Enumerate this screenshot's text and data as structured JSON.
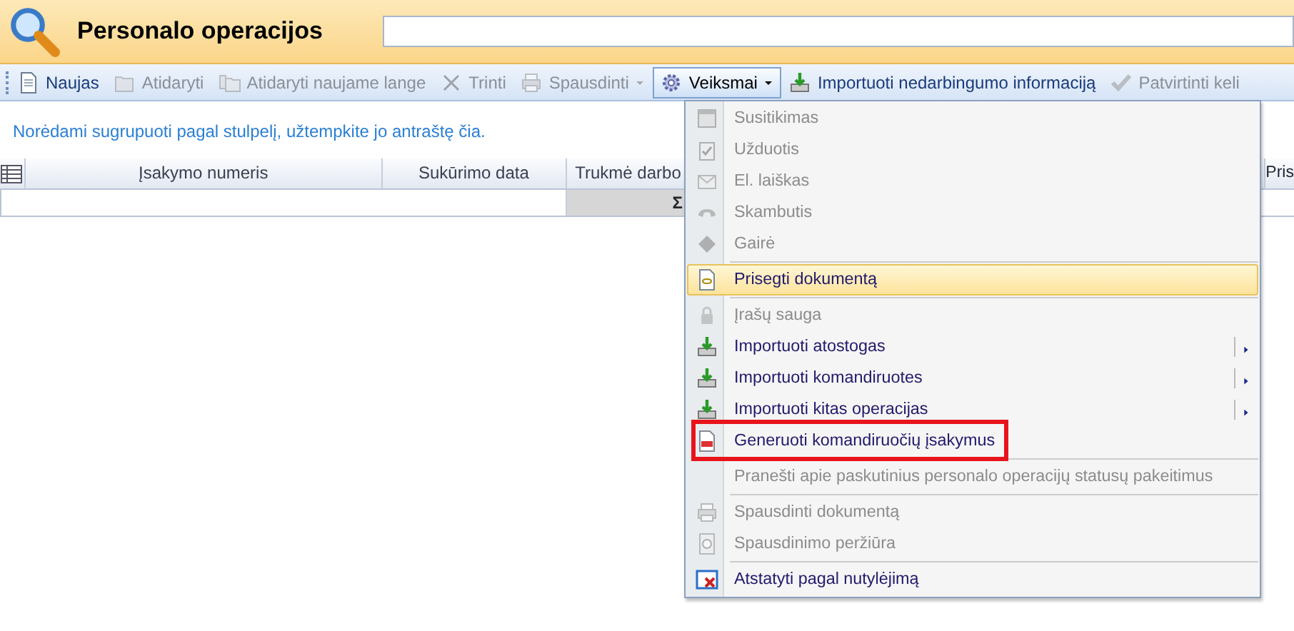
{
  "header": {
    "title": "Personalo operacijos"
  },
  "toolbar": [
    {
      "label": "Naujas",
      "disabled": false,
      "dropdown": false,
      "expanded": false
    },
    {
      "label": "Atidaryti",
      "disabled": true,
      "dropdown": false,
      "expanded": false
    },
    {
      "label": "Atidaryti naujame lange",
      "disabled": true,
      "dropdown": false,
      "expanded": false
    },
    {
      "label": "Trinti",
      "disabled": true,
      "dropdown": false,
      "expanded": false
    },
    {
      "label": "Spausdinti",
      "disabled": true,
      "dropdown": true,
      "expanded": false
    },
    {
      "label": "Veiksmai",
      "disabled": false,
      "dropdown": true,
      "expanded": true
    },
    {
      "label": "Importuoti nedarbingumo informaciją",
      "disabled": false,
      "dropdown": false,
      "expanded": false
    },
    {
      "label": "Patvirtinti keli",
      "disabled": true,
      "dropdown": false,
      "expanded": false
    }
  ],
  "grid": {
    "hint": "Norėdami sugrupuoti pagal stulpelį, užtempkite jo antraštę čia.",
    "columns": [
      {
        "label": "Įsakymo numeris"
      },
      {
        "label": "Sukūrimo data"
      },
      {
        "label": "Trukmė darbo"
      },
      {
        "label": "Pris"
      }
    ],
    "summary_sign": "Σ"
  },
  "menu": [
    {
      "kind": "item",
      "label": "Susitikimas",
      "disabled": true,
      "selected": false,
      "submenu": false,
      "annotated": false
    },
    {
      "kind": "item",
      "label": "Užduotis",
      "disabled": true,
      "selected": false,
      "submenu": false,
      "annotated": false
    },
    {
      "kind": "item",
      "label": "El. laiškas",
      "disabled": true,
      "selected": false,
      "submenu": false,
      "annotated": false
    },
    {
      "kind": "item",
      "label": "Skambutis",
      "disabled": true,
      "selected": false,
      "submenu": false,
      "annotated": false
    },
    {
      "kind": "item",
      "label": "Gairė",
      "disabled": true,
      "selected": false,
      "submenu": false,
      "annotated": false
    },
    {
      "kind": "separator"
    },
    {
      "kind": "item",
      "label": "Prisegti dokumentą",
      "disabled": false,
      "selected": true,
      "submenu": false,
      "annotated": false
    },
    {
      "kind": "separator"
    },
    {
      "kind": "item",
      "label": "Įrašų sauga",
      "disabled": true,
      "selected": false,
      "submenu": false,
      "annotated": false
    },
    {
      "kind": "item",
      "label": "Importuoti atostogas",
      "disabled": false,
      "selected": false,
      "submenu": true,
      "annotated": false
    },
    {
      "kind": "item",
      "label": "Importuoti komandiruotes",
      "disabled": false,
      "selected": false,
      "submenu": true,
      "annotated": false
    },
    {
      "kind": "item",
      "label": "Importuoti kitas operacijas",
      "disabled": false,
      "selected": false,
      "submenu": true,
      "annotated": false
    },
    {
      "kind": "item",
      "label": "Generuoti komandiruočių įsakymus",
      "disabled": false,
      "selected": false,
      "submenu": false,
      "annotated": true
    },
    {
      "kind": "separator"
    },
    {
      "kind": "item",
      "label": "Pranešti apie paskutinius personalo operacijų statusų pakeitimus",
      "disabled": true,
      "selected": false,
      "submenu": false,
      "annotated": false
    },
    {
      "kind": "separator"
    },
    {
      "kind": "item",
      "label": "Spausdinti dokumentą",
      "disabled": true,
      "selected": false,
      "submenu": false,
      "annotated": false
    },
    {
      "kind": "item",
      "label": "Spausdinimo peržiūra",
      "disabled": true,
      "selected": false,
      "submenu": false,
      "annotated": false
    },
    {
      "kind": "separator"
    },
    {
      "kind": "item",
      "label": "Atstatyti pagal nutylėjimą",
      "disabled": false,
      "selected": false,
      "submenu": false,
      "annotated": false
    }
  ]
}
